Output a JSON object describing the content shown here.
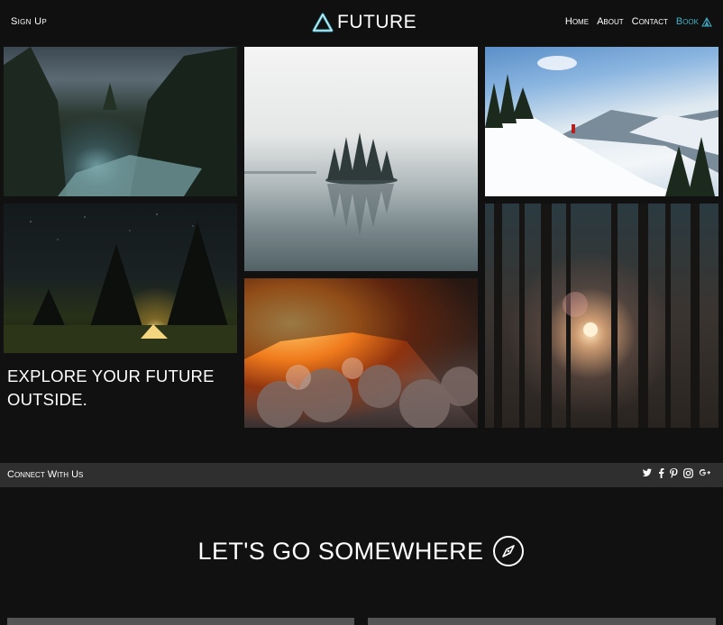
{
  "header": {
    "signup_label": "Sign Up",
    "brand_name": "FUTURE",
    "nav": [
      "Home",
      "About",
      "Contact",
      "Book"
    ],
    "accent_color": "#3fb1c9"
  },
  "hero": {
    "headline_line1": "EXPLORE YOUR FUTURE",
    "headline_line2": "OUTSIDE."
  },
  "gallery": [
    {
      "name": "river-valley-photo"
    },
    {
      "name": "foggy-lake-island-photo"
    },
    {
      "name": "snowy-mountain-hiker-photo"
    },
    {
      "name": "night-camping-tent-photo"
    },
    {
      "name": "sunset-clouds-photo"
    },
    {
      "name": "sunlit-forest-photo"
    }
  ],
  "connect": {
    "label": "Connect With Us",
    "icons": [
      "twitter-icon",
      "facebook-icon",
      "pinterest-icon",
      "instagram-icon",
      "google-plus-icon"
    ]
  },
  "section": {
    "title": "LET'S GO SOMEWHERE"
  }
}
